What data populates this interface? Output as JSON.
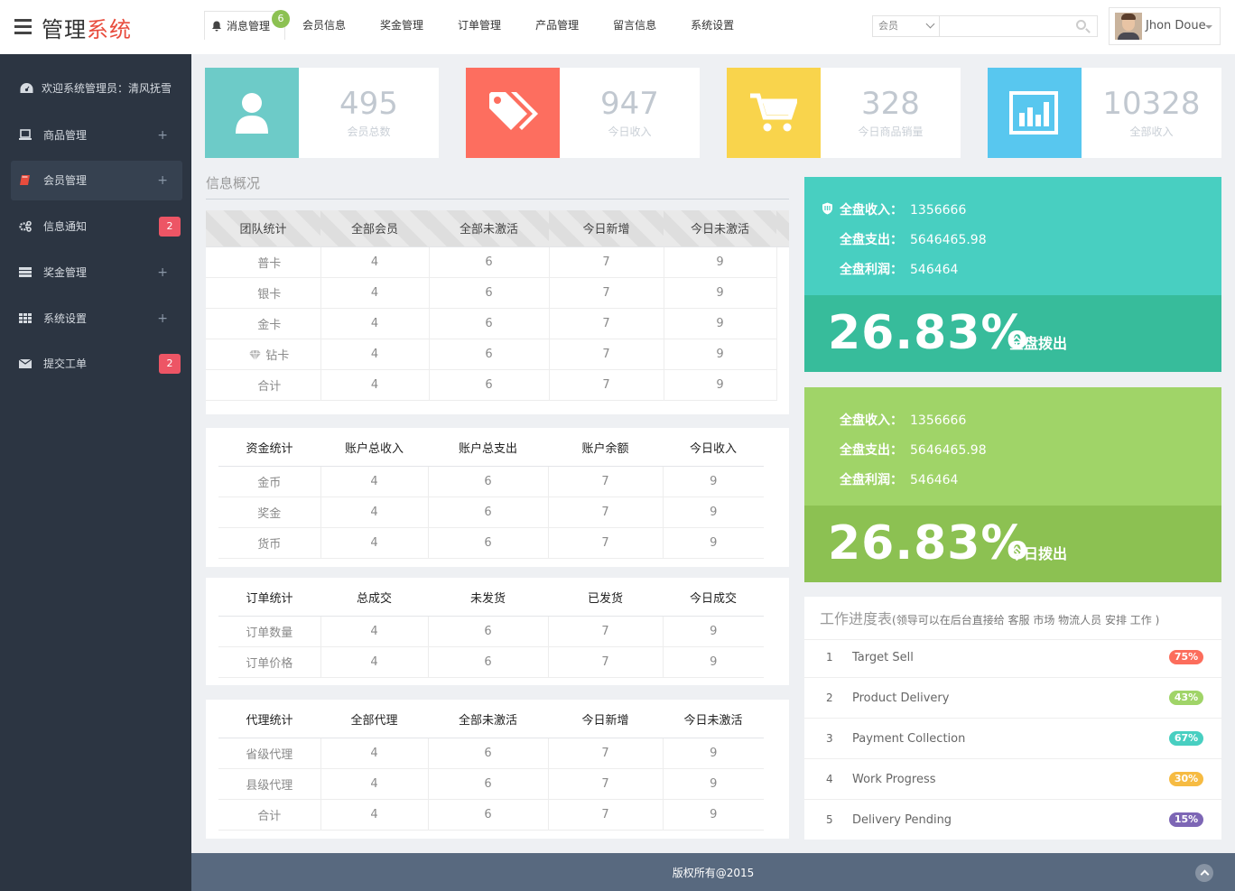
{
  "app": {
    "title_main": "管理",
    "title_accent": "系统",
    "accent_color": "#e84c3d"
  },
  "nav": {
    "messages": {
      "label": "消息管理",
      "count": "6"
    },
    "items": [
      "会员信息",
      "奖金管理",
      "订单管理",
      "产品管理",
      "留言信息",
      "系统设置"
    ]
  },
  "search": {
    "select_value": "会员",
    "placeholder": ""
  },
  "user": {
    "name": "Jhon Doue"
  },
  "sidebar": {
    "welcome": "欢迎系统管理员：清风抚雪",
    "items": [
      {
        "label": "商品管理",
        "marker": "+",
        "icon": "laptop-icon"
      },
      {
        "label": "会员管理",
        "marker": "+",
        "icon": "book-icon",
        "active": true
      },
      {
        "label": "信息通知",
        "badge": "2",
        "icon": "cogs-icon"
      },
      {
        "label": "奖金管理",
        "marker": "+",
        "icon": "server-icon"
      },
      {
        "label": "系统设置",
        "marker": "+",
        "icon": "grid-icon"
      },
      {
        "label": "提交工单",
        "badge": "2",
        "icon": "envelope-icon"
      }
    ]
  },
  "stats": [
    {
      "value": "495",
      "label": "会员总数",
      "color": "#6dcbc8",
      "icon": "user-icon"
    },
    {
      "value": "947",
      "label": "今日收入",
      "color": "#fd6e5f",
      "icon": "tags-icon"
    },
    {
      "value": "328",
      "label": "今日商品销量",
      "color": "#f9d44c",
      "icon": "cart-icon"
    },
    {
      "value": "10328",
      "label": "全部收入",
      "color": "#58c7ef",
      "icon": "chart-icon"
    }
  ],
  "info": {
    "title": "信息概况"
  },
  "tables": {
    "team": {
      "headers": [
        "团队统计",
        "全部会员",
        "全部未激活",
        "今日新增",
        "今日未激活"
      ],
      "rows": [
        [
          "普卡",
          "4",
          "6",
          "7",
          "9"
        ],
        [
          "银卡",
          "4",
          "6",
          "7",
          "9"
        ],
        [
          "金卡",
          "4",
          "6",
          "7",
          "9"
        ],
        [
          "钻卡",
          "4",
          "6",
          "7",
          "9"
        ],
        [
          "合计",
          "4",
          "6",
          "7",
          "9"
        ]
      ]
    },
    "funds": {
      "headers": [
        "资金统计",
        "账户总收入",
        "账户总支出",
        "账户余额",
        "今日收入"
      ],
      "rows": [
        [
          "金币",
          "4",
          "6",
          "7",
          "9"
        ],
        [
          "奖金",
          "4",
          "6",
          "7",
          "9"
        ],
        [
          "货币",
          "4",
          "6",
          "7",
          "9"
        ]
      ]
    },
    "orders": {
      "headers": [
        "订单统计",
        "总成交",
        "未发货",
        "已发货",
        "今日成交"
      ],
      "rows": [
        [
          "订单数量",
          "4",
          "6",
          "7",
          "9"
        ],
        [
          "订单价格",
          "4",
          "6",
          "7",
          "9"
        ]
      ]
    },
    "agents": {
      "headers": [
        "代理统计",
        "全部代理",
        "全部未激活",
        "今日新增",
        "今日未激活"
      ],
      "rows": [
        [
          "省级代理",
          "4",
          "6",
          "7",
          "9"
        ],
        [
          "县级代理",
          "4",
          "6",
          "7",
          "9"
        ],
        [
          "合计",
          "4",
          "6",
          "7",
          "9"
        ]
      ]
    }
  },
  "revenue": [
    {
      "income_label": "全盘收入：",
      "income": "1356666",
      "expense_label": "全盘支出：",
      "expense": "5646465.98",
      "profit_label": "全盘利润：",
      "profit": "546464",
      "percent": "26.83%",
      "percent_label": "全盘拨出",
      "color_top": "#48cfc1",
      "color_bottom": "#37bc9b"
    },
    {
      "income_label": "全盘收入：",
      "income": "1356666",
      "expense_label": "全盘支出：",
      "expense": "5646465.98",
      "profit_label": "全盘利润：",
      "profit": "546464",
      "percent": "26.83%",
      "percent_label": "今日拨出",
      "color_top": "#a0d468",
      "color_bottom": "#8cc152"
    }
  ],
  "work": {
    "title": "工作进度表",
    "subtitle": "(领导可以在后台直接给  客服 市场 物流人员 安排 工作 )",
    "items": [
      {
        "n": "1",
        "task": "Target Sell",
        "pct": "75%",
        "color": "#fc6d5c"
      },
      {
        "n": "2",
        "task": "Product Delivery",
        "pct": "43%",
        "color": "#a0d468"
      },
      {
        "n": "3",
        "task": "Payment Collection",
        "pct": "67%",
        "color": "#48cfc1"
      },
      {
        "n": "4",
        "task": "Work Progress",
        "pct": "30%",
        "color": "#f6bb42"
      },
      {
        "n": "5",
        "task": "Delivery Pending",
        "pct": "15%",
        "color": "#7d66b5"
      }
    ]
  },
  "footer": {
    "text": "版权所有@2015"
  }
}
